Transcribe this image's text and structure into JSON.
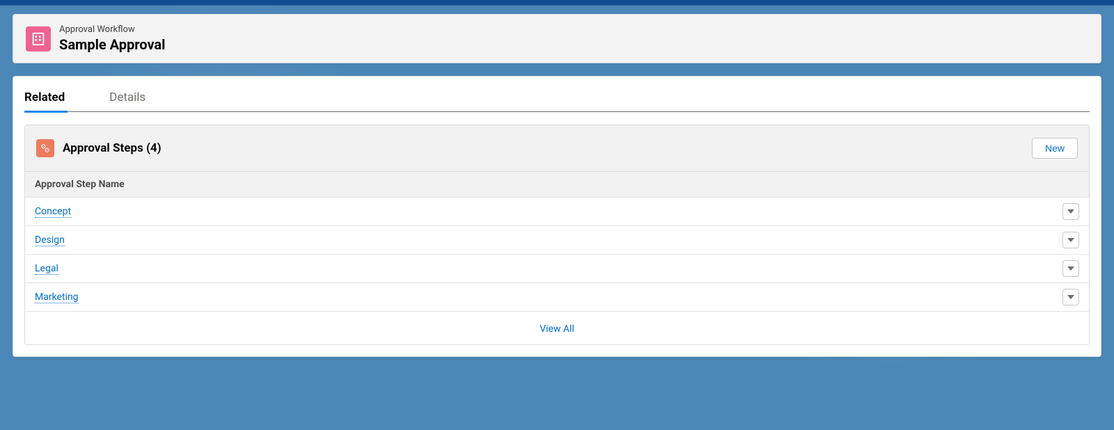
{
  "header": {
    "subtitle": "Approval Workflow",
    "title": "Sample Approval"
  },
  "tabs": [
    {
      "label": "Related",
      "active": true
    },
    {
      "label": "Details",
      "active": false
    }
  ],
  "related": {
    "title": "Approval Steps (4)",
    "new_button": "New",
    "column_header": "Approval Step Name",
    "rows": [
      {
        "name": "Concept"
      },
      {
        "name": "Design"
      },
      {
        "name": "Legal"
      },
      {
        "name": "Marketing"
      }
    ],
    "view_all": "View All"
  }
}
